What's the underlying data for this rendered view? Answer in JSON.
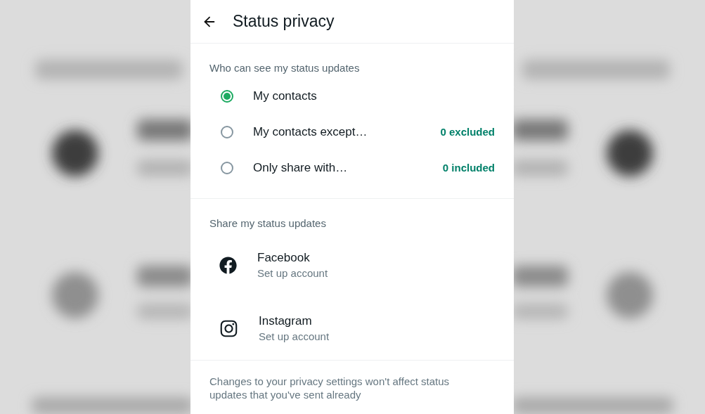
{
  "header": {
    "title": "Status privacy"
  },
  "audience": {
    "heading": "Who can see my status updates",
    "options": [
      {
        "label": "My contacts",
        "selected": true
      },
      {
        "label": "My contacts except…",
        "selected": false,
        "count": "0 excluded"
      },
      {
        "label": "Only share with…",
        "selected": false,
        "count": "0 included"
      }
    ]
  },
  "share": {
    "heading": "Share my status updates",
    "accounts": [
      {
        "kind": "facebook",
        "name": "Facebook",
        "subtitle": "Set up account"
      },
      {
        "kind": "instagram",
        "name": "Instagram",
        "subtitle": "Set up account"
      }
    ]
  },
  "footer_note": "Changes to your privacy settings won't affect status updates that you've sent already"
}
